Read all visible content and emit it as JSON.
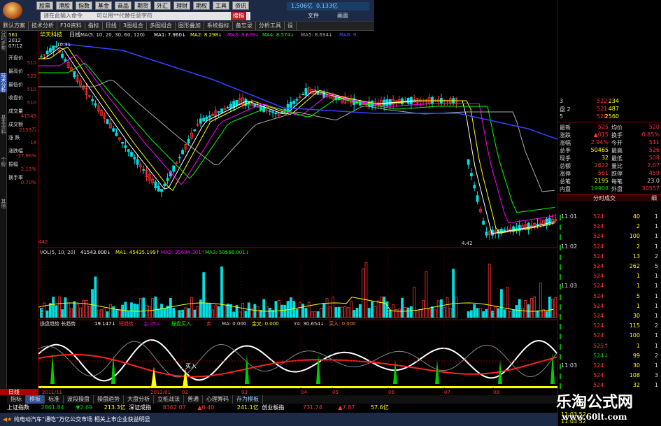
{
  "menu": {
    "items": [
      "股票",
      "港股",
      "指数",
      "基金",
      "商品",
      "期货",
      "外汇",
      "理财",
      "期权",
      "工具",
      "资讯"
    ],
    "search_placeholder": "请在此输入命令",
    "search_mid": "可以用**代替任意字符",
    "search_btn": "搜指",
    "quick_icons": [
      "1.506亿",
      "0.133亿"
    ],
    "file_menu": "文件",
    "window_menu": "画面"
  },
  "toolbar": {
    "items": [
      "默认方案",
      "技术分析",
      "F10资料",
      "指标",
      "日线",
      "3图组合",
      "多图组合",
      "图形叠加",
      "系统指标",
      "备忘录",
      "分析工具",
      "设"
    ]
  },
  "lefttabs": [
    "分时走势",
    "技术分析",
    "基本资料",
    "个股",
    "其他"
  ],
  "info": {
    "code": "561",
    "date": "2012",
    "date2": "07/12",
    "rows": [
      {
        "l": "开盘价",
        "v": "510"
      },
      {
        "l": "最高价",
        "v": "523"
      },
      {
        "l": "最低价",
        "v": "510"
      },
      {
        "l": "收盘价",
        "v": "510"
      },
      {
        "l": "成交量",
        "v": "41543"
      },
      {
        "l": "成交额",
        "v": "2159万"
      },
      {
        "l": "涨 跌",
        "v": "-18"
      },
      {
        "l": "涨跌幅",
        "v": "-37.96%"
      },
      {
        "l": "振幅",
        "v": "2.15%"
      },
      {
        "l": "换手率",
        "v": "0.70%"
      }
    ]
  },
  "chart": {
    "stock_name": "华天科技",
    "period": "日线",
    "ma_label": "MA(5, 10, 20, 30, 60, 120)",
    "ma1": "MA1: 7.960↓",
    "ma2": "MA2: 8.298↓",
    "ma3": "MA3: 8.678↓",
    "ma4": "MA4: 8.574↓",
    "ma5": "MA5: 8.694↓",
    "ma6": "MA6: 9.",
    "high_label": "10.31",
    "low_label": "4.42",
    "y_top": "966",
    "y_bottom": "442",
    "vol_label": "VOL(5, 10, 20)",
    "vol_val": "41543.000↓",
    "vma1": "MA1: 45435.199↑",
    "vma2": "MA2: 35694.301↑",
    "vma3": "MA3: 50566.001↓",
    "vol_y1": "13726",
    "vol_y2": "6528",
    "vol_y3": "10",
    "ind_label": "操盘趋势 长趋势",
    "ind_val": "19.147↓",
    "ind_parts": [
      "短趋势",
      "主 45↓",
      "操盘买入:",
      "卖",
      "MA: 0.000",
      "金叉: 0.000",
      "Y4: 30.654↓",
      "买入: 0.000"
    ],
    "ind_y1": "89.64",
    "ind_y2": "44.51",
    "ind_y3": "0.00",
    "buy_tag": "买入",
    "axis_labels": [
      "2011/11",
      "2012/01",
      "02",
      "03",
      "04",
      "05",
      "06",
      "07",
      "08"
    ],
    "buy_signals": [
      "0000",
      "买",
      "卖"
    ]
  },
  "chart_data": {
    "type": "candlestick",
    "price_range": [
      4.42,
      10.31
    ],
    "note_points": {
      "high": 10.31,
      "low": 4.42
    }
  },
  "right": {
    "orderbook": [
      {
        "r": "3",
        "p": "522",
        "v": "234"
      },
      {
        "r": "盘 2",
        "p": "521",
        "v": "487"
      },
      {
        "r": "5",
        "p": "520",
        "v": "2560"
      }
    ],
    "quote": [
      {
        "l": "最新",
        "v": "525",
        "l2": "均价",
        "v2": "520"
      },
      {
        "l": "涨跌",
        "v": "▲015",
        "l2": "换手",
        "v2": "0.85%"
      },
      {
        "l": "涨幅",
        "v": "2.94%",
        "l2": "今开",
        "v2": "511"
      },
      {
        "l": "总手",
        "v": "50465",
        "l2": "最高",
        "v2": "526"
      },
      {
        "l": "现手",
        "v": "32",
        "l2": "最低",
        "v2": "508"
      },
      {
        "l": "总额",
        "v": "2622",
        "l2": "量比",
        "v2": "2.07"
      },
      {
        "l": "涨停",
        "v": "561",
        "l2": "跌停",
        "v2": "459"
      },
      {
        "l": "总笔",
        "v": "2195",
        "l2": "每笔",
        "v2": "23.0"
      },
      {
        "l": "内盘",
        "v": "19908",
        "l2": "外盘",
        "v2": "30557"
      }
    ],
    "tick_title": "分时成交",
    "tick_tab": "细",
    "ticks": [
      {
        "t": "11:01",
        "p": "524",
        "v": "40",
        "n": "1"
      },
      {
        "t": "",
        "p": "524",
        "v": "2",
        "n": "1"
      },
      {
        "t": "",
        "p": "524",
        "v": "100",
        "n": "1"
      },
      {
        "t": "11:02",
        "p": "524",
        "v": "2",
        "n": "1"
      },
      {
        "t": "",
        "p": "524",
        "v": "13",
        "n": "2"
      },
      {
        "t": "",
        "p": "524",
        "v": "262",
        "n": "5"
      },
      {
        "t": "",
        "p": "524",
        "v": "1",
        "n": "1"
      },
      {
        "t": "11:03",
        "p": "524",
        "v": "1",
        "n": "1"
      },
      {
        "t": "",
        "p": "524",
        "v": "5",
        "n": "1"
      },
      {
        "t": "",
        "p": "524",
        "v": "1",
        "n": "1"
      },
      {
        "t": "",
        "p": "524",
        "v": "30",
        "n": "1"
      },
      {
        "t": "",
        "p": "524",
        "v": "115",
        "n": "2"
      },
      {
        "t": "",
        "p": "524",
        "v": "100",
        "n": "1"
      },
      {
        "t": "",
        "p": "525↑",
        "v": "1",
        "n": "1"
      },
      {
        "t": "",
        "p": "524↓",
        "v": "99",
        "n": "2"
      },
      {
        "t": "11:03",
        "p": "524",
        "v": "30",
        "n": "1"
      },
      {
        "t": "",
        "p": "524",
        "v": "108",
        "n": "3"
      },
      {
        "t": "",
        "p": "524",
        "v": "32",
        "n": "1"
      }
    ],
    "bottom_times": [
      "11:03 52",
      "11:03 52"
    ]
  },
  "bottom": {
    "tabs": [
      "指标",
      "模板",
      "标准",
      "波段操盘",
      "操盘趋势",
      "大盘分析",
      "立桩战法",
      "普通",
      "心理筹码",
      "存为模板"
    ],
    "k_tab": "日线",
    "index_name": "上证指数",
    "index_val": "2861.84",
    "index_chg": "▼2.69",
    "index_amt": "213.3亿",
    "sz_name": "深证成指",
    "sz_val": "8362.07",
    "sz_chg": "▲0.40",
    "sz_amt": "241.1亿",
    "cy_name": "创业板指",
    "cy_val": "731.74",
    "cy_chg": "▲7.87",
    "cy_amt": "57.6亿",
    "news": "纯电动汽车“通吃”万亿公交市场  相关上市企业获益明显"
  },
  "watermark": {
    "title": "乐淘公式网",
    "url": "www.60lt.com"
  },
  "colors": {
    "up": "#ff3333",
    "down": "#00e0e0",
    "ma5": "#ffffff",
    "ma10": "#ffff00",
    "ma20": "#ff00ff",
    "ma30": "#00ff00",
    "ma60": "#aaaaaa",
    "ma120": "#3344ff",
    "watermark_bg": "#000000"
  }
}
